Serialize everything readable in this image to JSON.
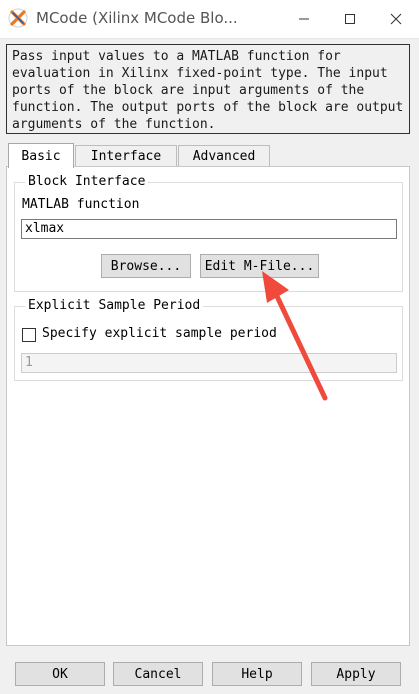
{
  "window": {
    "title": "MCode (Xilinx MCode Blo...",
    "minimize_icon": "minimize-icon",
    "maximize_icon": "maximize-icon",
    "close_icon": "close-icon",
    "app_icon": "xilinx-logo-icon"
  },
  "description": {
    "lines": [
      "Pass input values to a MATLAB function for",
      "evaluation in Xilinx fixed-point type. The input",
      "ports of the block are input arguments of the",
      "function. The output ports of the block are output",
      "arguments of the function."
    ]
  },
  "tabs": [
    {
      "label": "Basic",
      "active": true
    },
    {
      "label": "Interface",
      "active": false
    },
    {
      "label": "Advanced",
      "active": false
    }
  ],
  "block_interface": {
    "title": "Block Interface",
    "function_label": "MATLAB function",
    "function_value": "xlmax",
    "browse_label": "Browse...",
    "edit_label": "Edit M-File..."
  },
  "sample_period": {
    "title": "Explicit Sample Period",
    "checkbox_label": "Specify explicit sample period",
    "checked": false,
    "period_value": "1"
  },
  "footer": {
    "ok": "OK",
    "cancel": "Cancel",
    "help": "Help",
    "apply": "Apply"
  },
  "colors": {
    "annotation_arrow": "#f04a3c",
    "panel_bg": "#ffffff",
    "window_bg": "#f0f0f0"
  }
}
